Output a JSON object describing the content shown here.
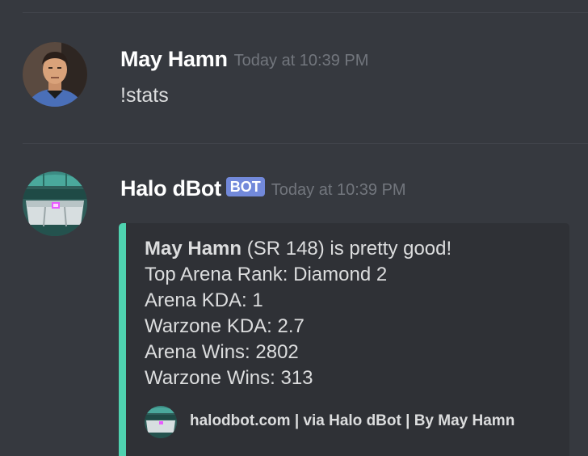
{
  "messages": [
    {
      "author": "May Hamn",
      "timestamp": "Today at 10:39 PM",
      "content": "!stats",
      "avatar_icon": "user-avatar"
    },
    {
      "author": "Halo dBot",
      "bot_tag": "BOT",
      "timestamp": "Today at 10:39 PM",
      "avatar_icon": "halo-helmet-avatar",
      "embed": {
        "accent_color": "#4fd3b0",
        "lines": {
          "player_name": "May Hamn",
          "headline_rest": " (SR 148) is pretty good!",
          "arena_rank": "Top Arena Rank: Diamond 2",
          "arena_kda": "Arena KDA: 1",
          "warzone_kda": "Warzone KDA: 2.7",
          "arena_wins": "Arena Wins: 2802",
          "warzone_wins": "Warzone Wins: 313"
        },
        "footer": {
          "icon": "halo-helmet-icon",
          "text": "halodbot.com | via Halo dBot | By May Hamn"
        }
      }
    }
  ],
  "colors": {
    "background": "#36393f",
    "embed_background": "#2f3136",
    "bot_tag": "#7289da",
    "timestamp": "#72767d"
  }
}
